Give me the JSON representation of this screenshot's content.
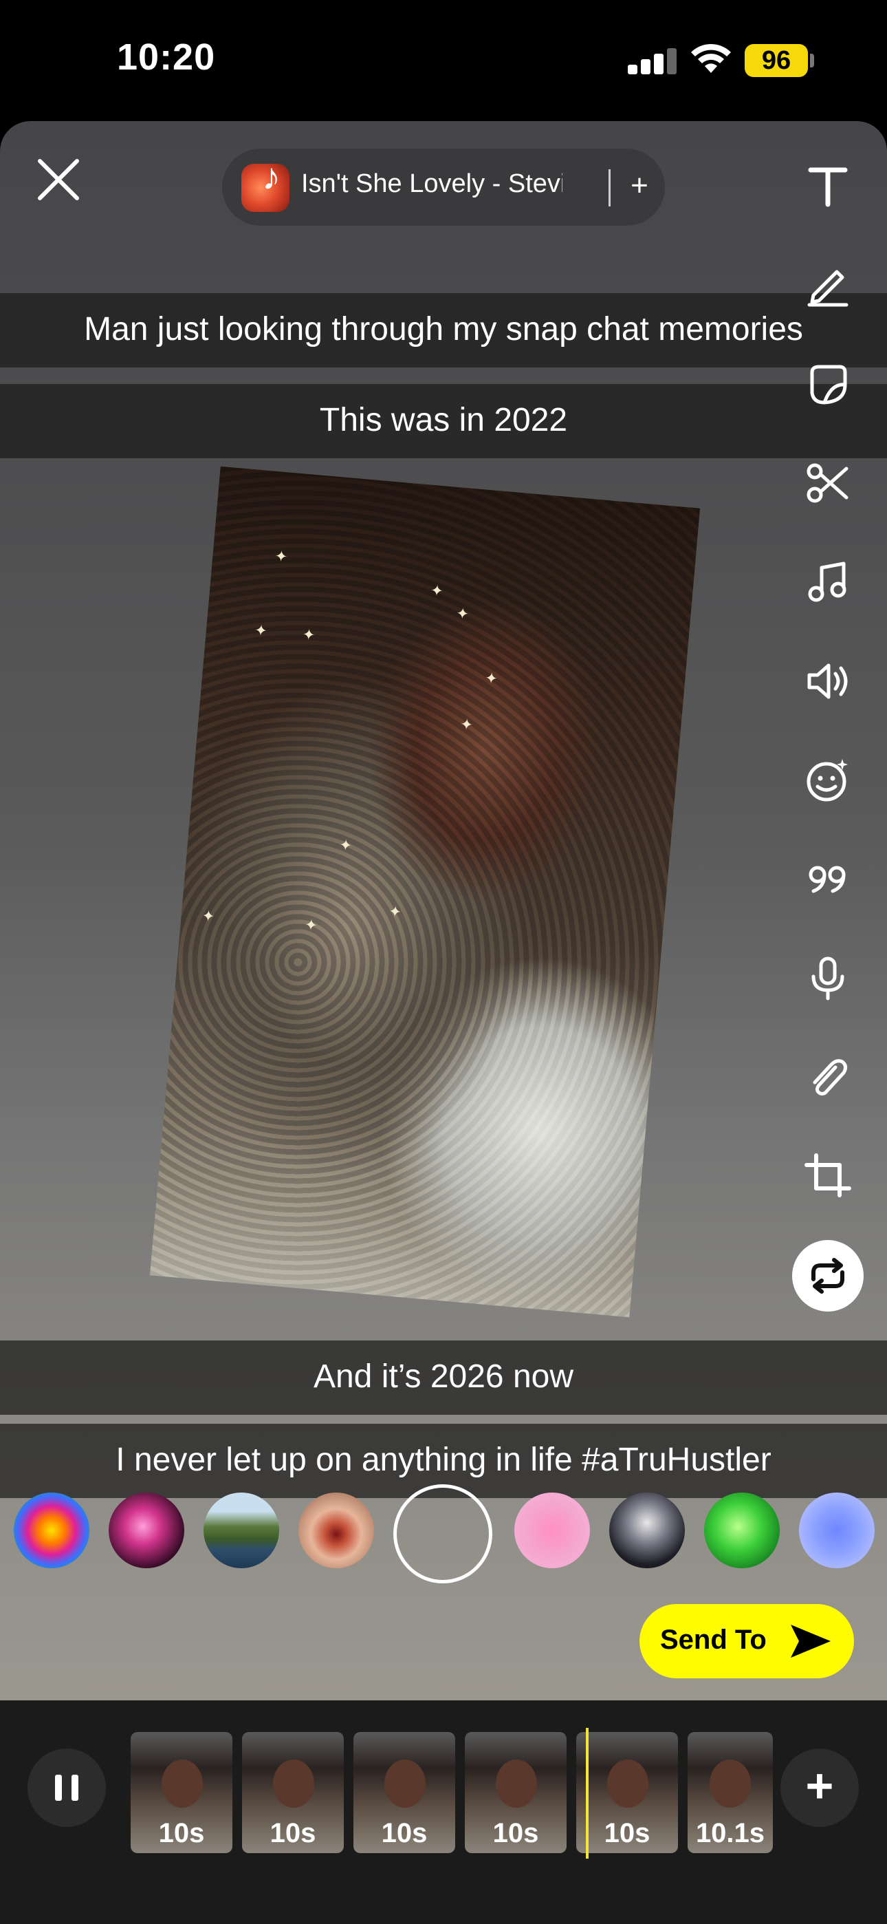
{
  "status_bar": {
    "time": "10:20",
    "battery": "96"
  },
  "music": {
    "title": "Isn't She Lovely - Stevie...",
    "add_label": "+"
  },
  "captions": {
    "line1": "Man just looking through my snap chat memories",
    "line2": "This was in 2022",
    "line3": "And it’s 2026 now",
    "line4": "I never let up on anything in life #aTruHustler"
  },
  "tools": [
    "text-icon",
    "draw-icon",
    "sticker-icon",
    "scissors-icon",
    "music-icon",
    "sound-icon",
    "lens-icon",
    "quote-icon",
    "mic-icon",
    "attach-icon",
    "crop-icon",
    "loop-icon"
  ],
  "lenses": [
    "rainbow-mandala-lens",
    "neon-heart-lens",
    "island-lens",
    "face-lens",
    "pink-glow-lens",
    "cowboy-hat-lens",
    "extra-gum-lens",
    "blue-portal-lens"
  ],
  "send": {
    "label": "Send To"
  },
  "timeline": {
    "clips": [
      {
        "label": "10s"
      },
      {
        "label": "10s"
      },
      {
        "label": "10s"
      },
      {
        "label": "10s"
      },
      {
        "label": "10s"
      },
      {
        "label": "10.1s"
      }
    ],
    "add_label": "+"
  },
  "colors": {
    "accent_yellow": "#fffc00",
    "battery": "#f5d90a",
    "playhead": "#f5e43a"
  }
}
